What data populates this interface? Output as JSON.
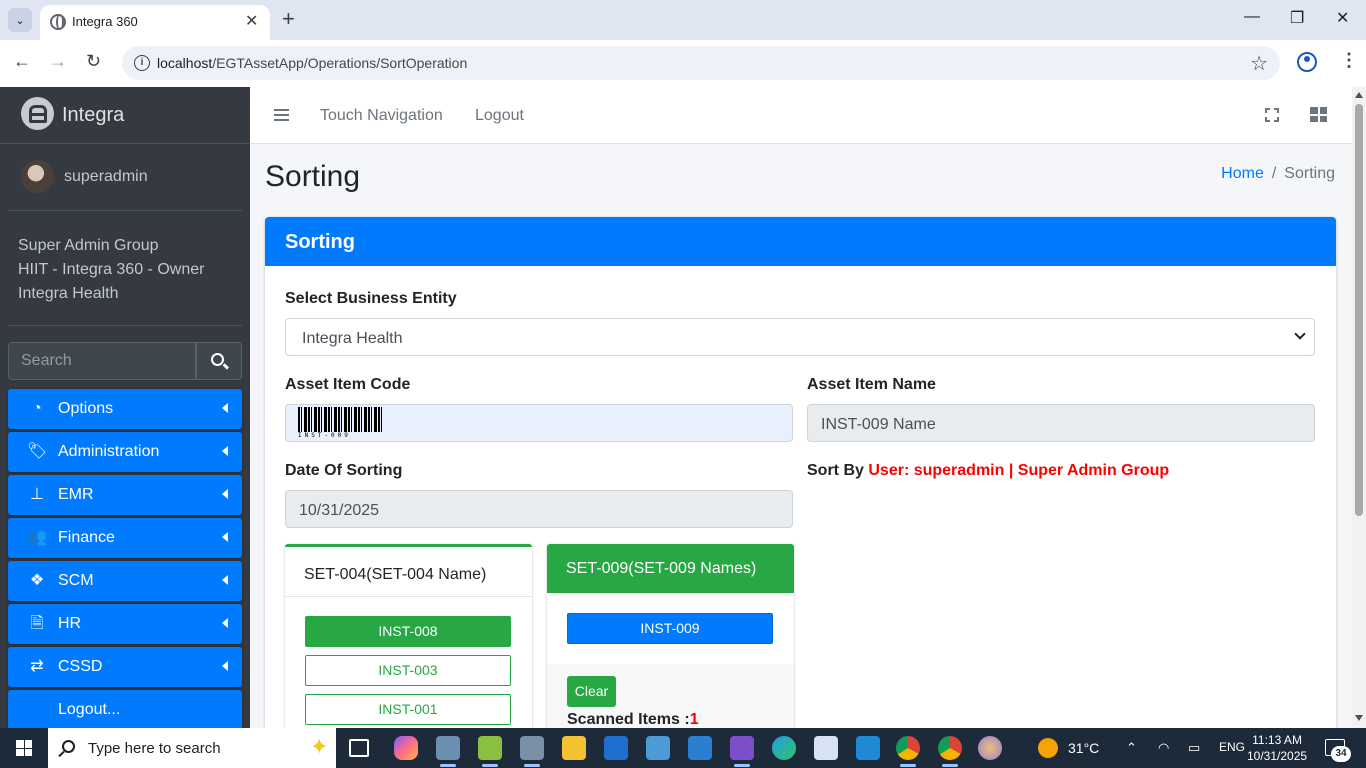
{
  "browser": {
    "tab_title": "Integra 360",
    "url_host": "localhost",
    "url_path": "/EGTAssetApp/Operations/SortOperation"
  },
  "sidebar": {
    "brand": "Integra",
    "user": "superadmin",
    "groups": [
      "Super Admin Group",
      "HIIT - Integra 360 - Owner",
      "Integra Health"
    ],
    "search_placeholder": "Search",
    "menu": [
      {
        "label": "Options",
        "icon": "dashboard-icon"
      },
      {
        "label": "Administration",
        "icon": "tags-icon"
      },
      {
        "label": "EMR",
        "icon": "sitemap-icon"
      },
      {
        "label": "Finance",
        "icon": "users-icon"
      },
      {
        "label": "SCM",
        "icon": "cubes-icon"
      },
      {
        "label": "HR",
        "icon": "file-icon"
      },
      {
        "label": "CSSD",
        "icon": "exchange-icon"
      }
    ],
    "logout": "Logout..."
  },
  "header": {
    "nav_touch": "Touch Navigation",
    "nav_logout": "Logout"
  },
  "page": {
    "title": "Sorting",
    "breadcrumb_home": "Home",
    "breadcrumb_current": "Sorting"
  },
  "form": {
    "card_title": "Sorting",
    "business_entity_label": "Select Business Entity",
    "business_entity_value": "Integra Health",
    "asset_code_label": "Asset Item Code",
    "asset_code_barcode_caption": "INST-009",
    "asset_name_label": "Asset Item Name",
    "asset_name_value": "INST-009 Name",
    "date_label": "Date Of Sorting",
    "date_value": "10/31/2025",
    "sort_by_label": "Sort By",
    "sort_by_value": "User: superadmin | Super Admin Group"
  },
  "sets": [
    {
      "title": "SET-004(SET-004 Name)",
      "items": [
        "INST-008",
        "INST-003",
        "INST-001"
      ]
    },
    {
      "title": "SET-009(SET-009 Names)",
      "items": [
        "INST-009"
      ],
      "clear_label": "Clear",
      "scanned_label": "Scanned Items :",
      "scanned_count": "1"
    }
  ],
  "taskbar": {
    "search_placeholder": "Type here to search",
    "temperature": "31°C",
    "language": "ENG",
    "time": "11:13 AM",
    "date": "10/31/2025",
    "notification_count": "34"
  },
  "colors": {
    "primary": "#007bff",
    "success": "#28a745",
    "sidebar": "#343a40",
    "danger": "#ff0000"
  }
}
